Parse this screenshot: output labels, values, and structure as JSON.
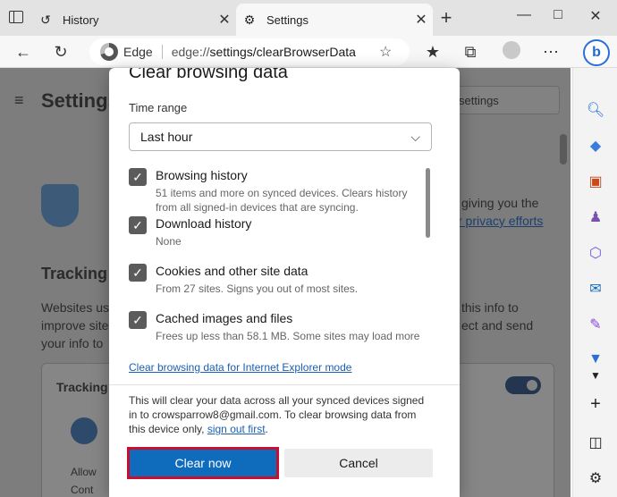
{
  "tabs": [
    {
      "label": "History"
    },
    {
      "label": "Settings"
    }
  ],
  "address": {
    "browser_label": "Edge",
    "url_host": "edge://",
    "url_path": "settings/clearBrowserData"
  },
  "background": {
    "title": "Settings",
    "search_placeholder": "settings",
    "section_heading": "Tracking",
    "frag_giving": "giving you the",
    "frag_privacy_link": "r privacy efforts",
    "frag_websites": "Websites us",
    "frag_improve": "improve site",
    "frag_your_info": "your info to",
    "frag_this_info": "this info to",
    "frag_ect_send": "ect and send",
    "card_title": "Tracking",
    "bullet1": "Allow",
    "bullet2": "Cont"
  },
  "dialog": {
    "title": "Clear browsing data",
    "time_range_label": "Time range",
    "time_range_value": "Last hour",
    "items": [
      {
        "title": "Browsing history",
        "desc": "51 items and more on synced devices. Clears history from all signed-in devices that are syncing.",
        "checked": true
      },
      {
        "title": "Download history",
        "desc": "None",
        "checked": true
      },
      {
        "title": "Cookies and other site data",
        "desc": "From 27 sites. Signs you out of most sites.",
        "checked": true
      },
      {
        "title": "Cached images and files",
        "desc": "Frees up less than 58.1 MB. Some sites may load more",
        "checked": true
      }
    ],
    "ie_link": "Clear browsing data for Internet Explorer mode",
    "info_prefix": "This will clear your data across all your synced devices signed in to crowsparrow8@gmail.com. To clear browsing data from this device only,",
    "info_link": "sign out first",
    "info_suffix": ".",
    "clear_button": "Clear now",
    "cancel_button": "Cancel"
  },
  "colors": {
    "accent": "#0f6cbd",
    "highlight_border": "#c8102e",
    "overlay": "#7d7d7d"
  }
}
